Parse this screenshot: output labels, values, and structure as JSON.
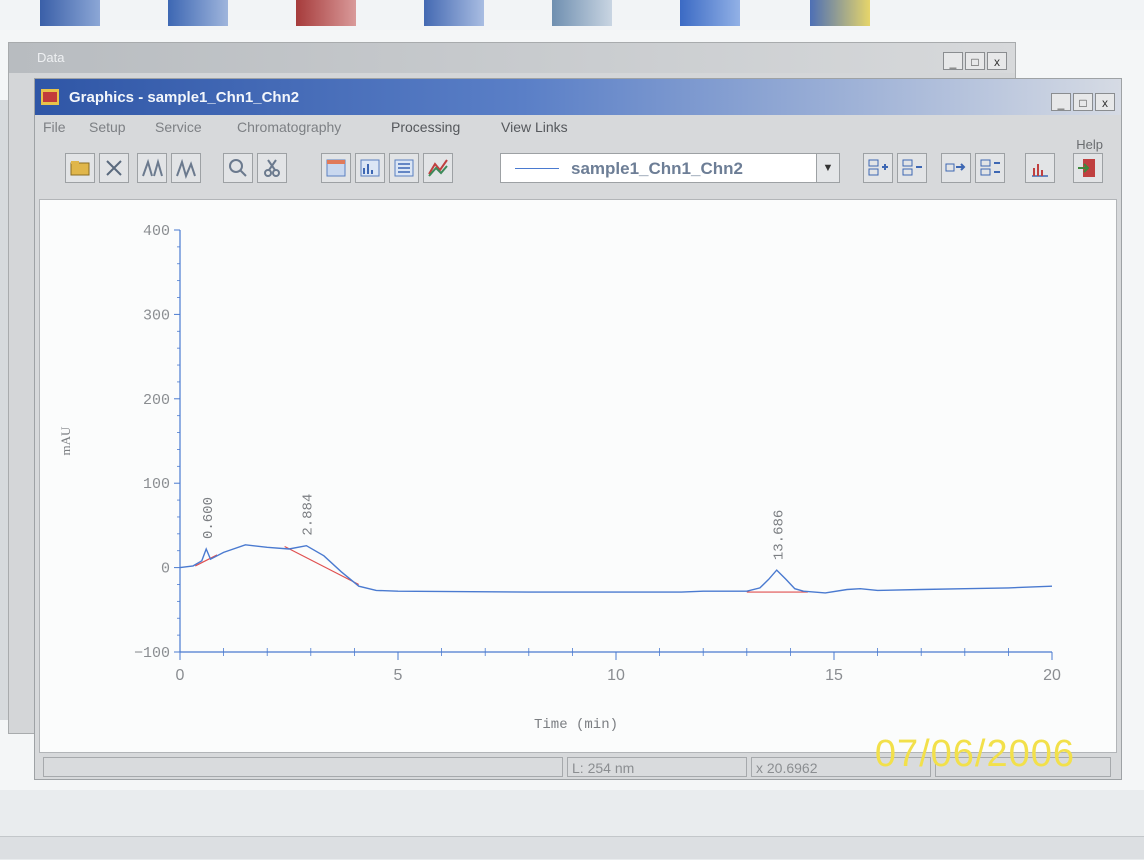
{
  "background_window": {
    "title": "Data"
  },
  "main_window": {
    "title": "Graphics - sample1_Chn1_Chn2",
    "controls": {
      "minimize": "_",
      "maximize": "□",
      "close": "x"
    }
  },
  "menu": {
    "items": [
      "File",
      "Setup",
      "Service",
      "Chromatography",
      "Processing",
      "View Links"
    ],
    "help": "Help"
  },
  "toolbar": {
    "trace_selector_value": "sample1_Chn1_Chn2"
  },
  "status": {
    "wavelength": "L: 254 nm",
    "x_readout": "x 20.6962",
    "date_stamp": "07/06/2006"
  },
  "colors": {
    "trace": "#4a7ad0",
    "baseline": "#e05050",
    "axis": "#4a7ad0",
    "titlebar": "#2f56a6"
  },
  "chart_data": {
    "type": "line",
    "xlabel": "Time (min)",
    "ylabel": "mAU",
    "xlim": [
      0,
      20
    ],
    "ylim": [
      -100,
      400
    ],
    "x_ticks": [
      0,
      5,
      10,
      15,
      20
    ],
    "y_ticks": [
      -100,
      0,
      100,
      200,
      300,
      400
    ],
    "grid": false,
    "series": [
      {
        "x": [
          0,
          0.3,
          0.5,
          0.6,
          0.7,
          1.0,
          1.5,
          2.0,
          2.5,
          2.9,
          3.3,
          3.7,
          4.1,
          4.5,
          5,
          8,
          10,
          11.5,
          12,
          13,
          13.3,
          13.5,
          13.686,
          13.9,
          14.1,
          14.3,
          14.8,
          15.3,
          15.6,
          16,
          17,
          18,
          19,
          20
        ],
        "y": [
          0,
          2,
          8,
          22,
          10,
          18,
          27,
          24,
          22,
          26,
          14,
          -5,
          -22,
          -27,
          -28,
          -29,
          -29,
          -29,
          -28,
          -28,
          -24,
          -14,
          -3,
          -14,
          -25,
          -28,
          -30,
          -26,
          -25,
          -27,
          -26,
          -25,
          -24,
          -22
        ]
      }
    ],
    "baseline_segments": [
      {
        "x": [
          0.35,
          0.85
        ],
        "y": [
          2,
          15
        ]
      },
      {
        "x": [
          2.4,
          4.1
        ],
        "y": [
          25,
          -20
        ]
      },
      {
        "x": [
          13.0,
          14.4
        ],
        "y": [
          -29,
          -29
        ]
      }
    ],
    "peak_labels": [
      {
        "x": 0.6,
        "y": 22,
        "text": "0.600"
      },
      {
        "x": 2.884,
        "y": 26,
        "text": "2.884"
      },
      {
        "x": 13.686,
        "y": -3,
        "text": "13.686"
      }
    ]
  }
}
